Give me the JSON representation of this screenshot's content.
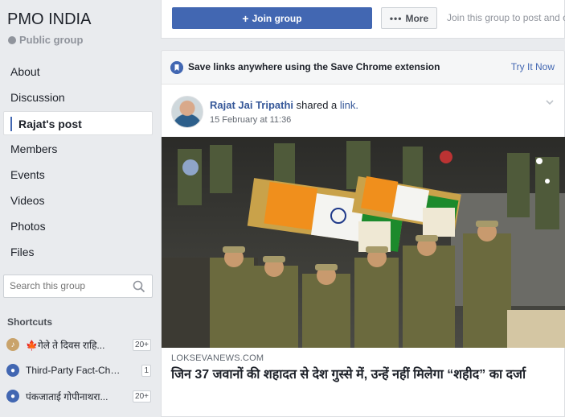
{
  "group": {
    "title": "PMO INDIA",
    "type": "Public group"
  },
  "nav": [
    {
      "label": "About",
      "active": false
    },
    {
      "label": "Discussion",
      "active": false
    },
    {
      "label": "Rajat's post",
      "active": true
    },
    {
      "label": "Members",
      "active": false
    },
    {
      "label": "Events",
      "active": false
    },
    {
      "label": "Videos",
      "active": false
    },
    {
      "label": "Photos",
      "active": false
    },
    {
      "label": "Files",
      "active": false
    }
  ],
  "search": {
    "placeholder": "Search this group"
  },
  "shortcuts": {
    "title": "Shortcuts",
    "items": [
      {
        "label": "🍁गेले ते दिवस राहि...",
        "count": "20+",
        "icon": "guitar-icon"
      },
      {
        "label": "Third-Party Fact-Che...",
        "count": "1",
        "icon": "group-icon"
      },
      {
        "label": "पंकजाताई गोपीनाथरा...",
        "count": "20+",
        "icon": "group-icon"
      }
    ]
  },
  "join_bar": {
    "join_label": "Join group",
    "more_label": "More",
    "hint": "Join this group to post and c"
  },
  "extension_bar": {
    "text": "Save links anywhere using the Save Chrome extension",
    "link": "Try It Now"
  },
  "post": {
    "author": "Rajat Jai Tripathi",
    "action": "shared a",
    "object": "link.",
    "time": "15 February at 11:36",
    "link_domain": "LOKSEVANEWS.COM",
    "link_headline": "जिन 37 जवानों की शहादत से देश गुस्से में, उन्हें नहीं मिलेगा “शहीद” का दर्जा"
  },
  "colors": {
    "brand": "#4267b2",
    "link": "#365899",
    "background": "#e9ebee"
  }
}
